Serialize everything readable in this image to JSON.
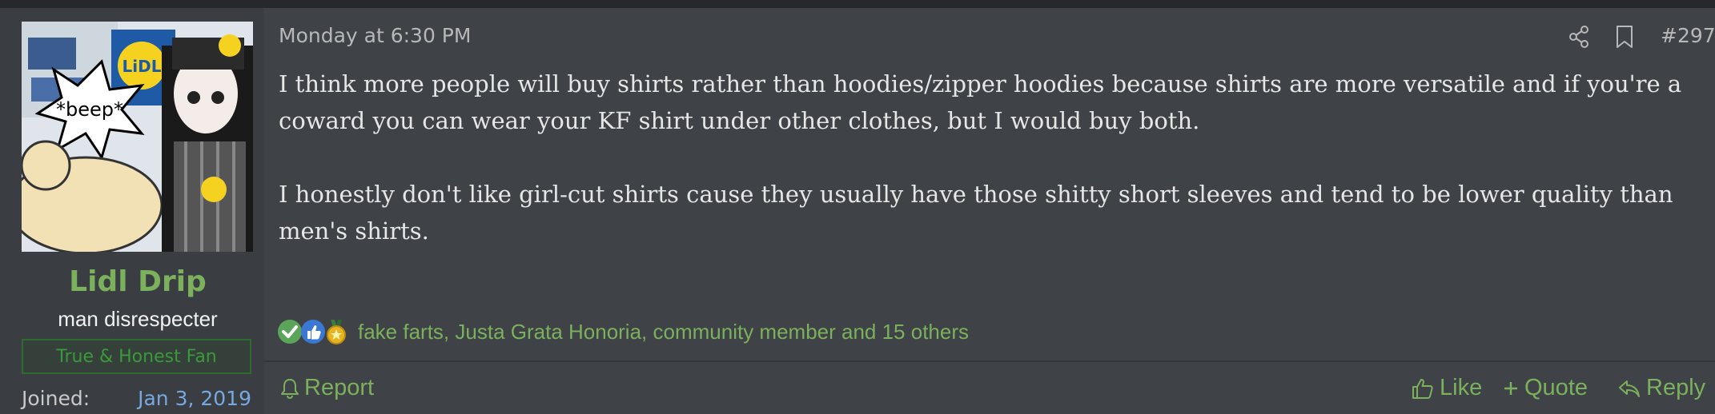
{
  "user": {
    "avatar_text": "*beep*",
    "avatar_logo": "LiDL",
    "name": "Lidl Drip",
    "title": "man disrespecter",
    "banner": "True & Honest Fan",
    "joined_label": "Joined:",
    "joined_value": "Jan 3, 2019"
  },
  "post": {
    "date": "Monday at 6:30 PM",
    "number": "#297",
    "paragraphs": [
      "I think more people will buy shirts rather than hoodies/zipper hoodies because shirts are more versatile and if you're a coward you can wear your KF shirt under other clothes, but I would buy both.",
      "I honestly don't like girl-cut shirts cause they usually have those shitty short sleeves and tend to be lower quality than men's shirts."
    ],
    "reactions_text": "fake farts, Justa Grata Honoria, community member and 15 others",
    "reaction_icons": [
      "check-icon",
      "thumbs-up-icon",
      "medal-icon"
    ]
  },
  "actions": {
    "report": "Report",
    "like": "Like",
    "quote": "Quote",
    "reply": "Reply"
  },
  "colors": {
    "accent_green": "#7bb05c",
    "link_blue": "#77a9e0",
    "bg_main": "#3f4246",
    "bg_user": "#3a3d41"
  }
}
